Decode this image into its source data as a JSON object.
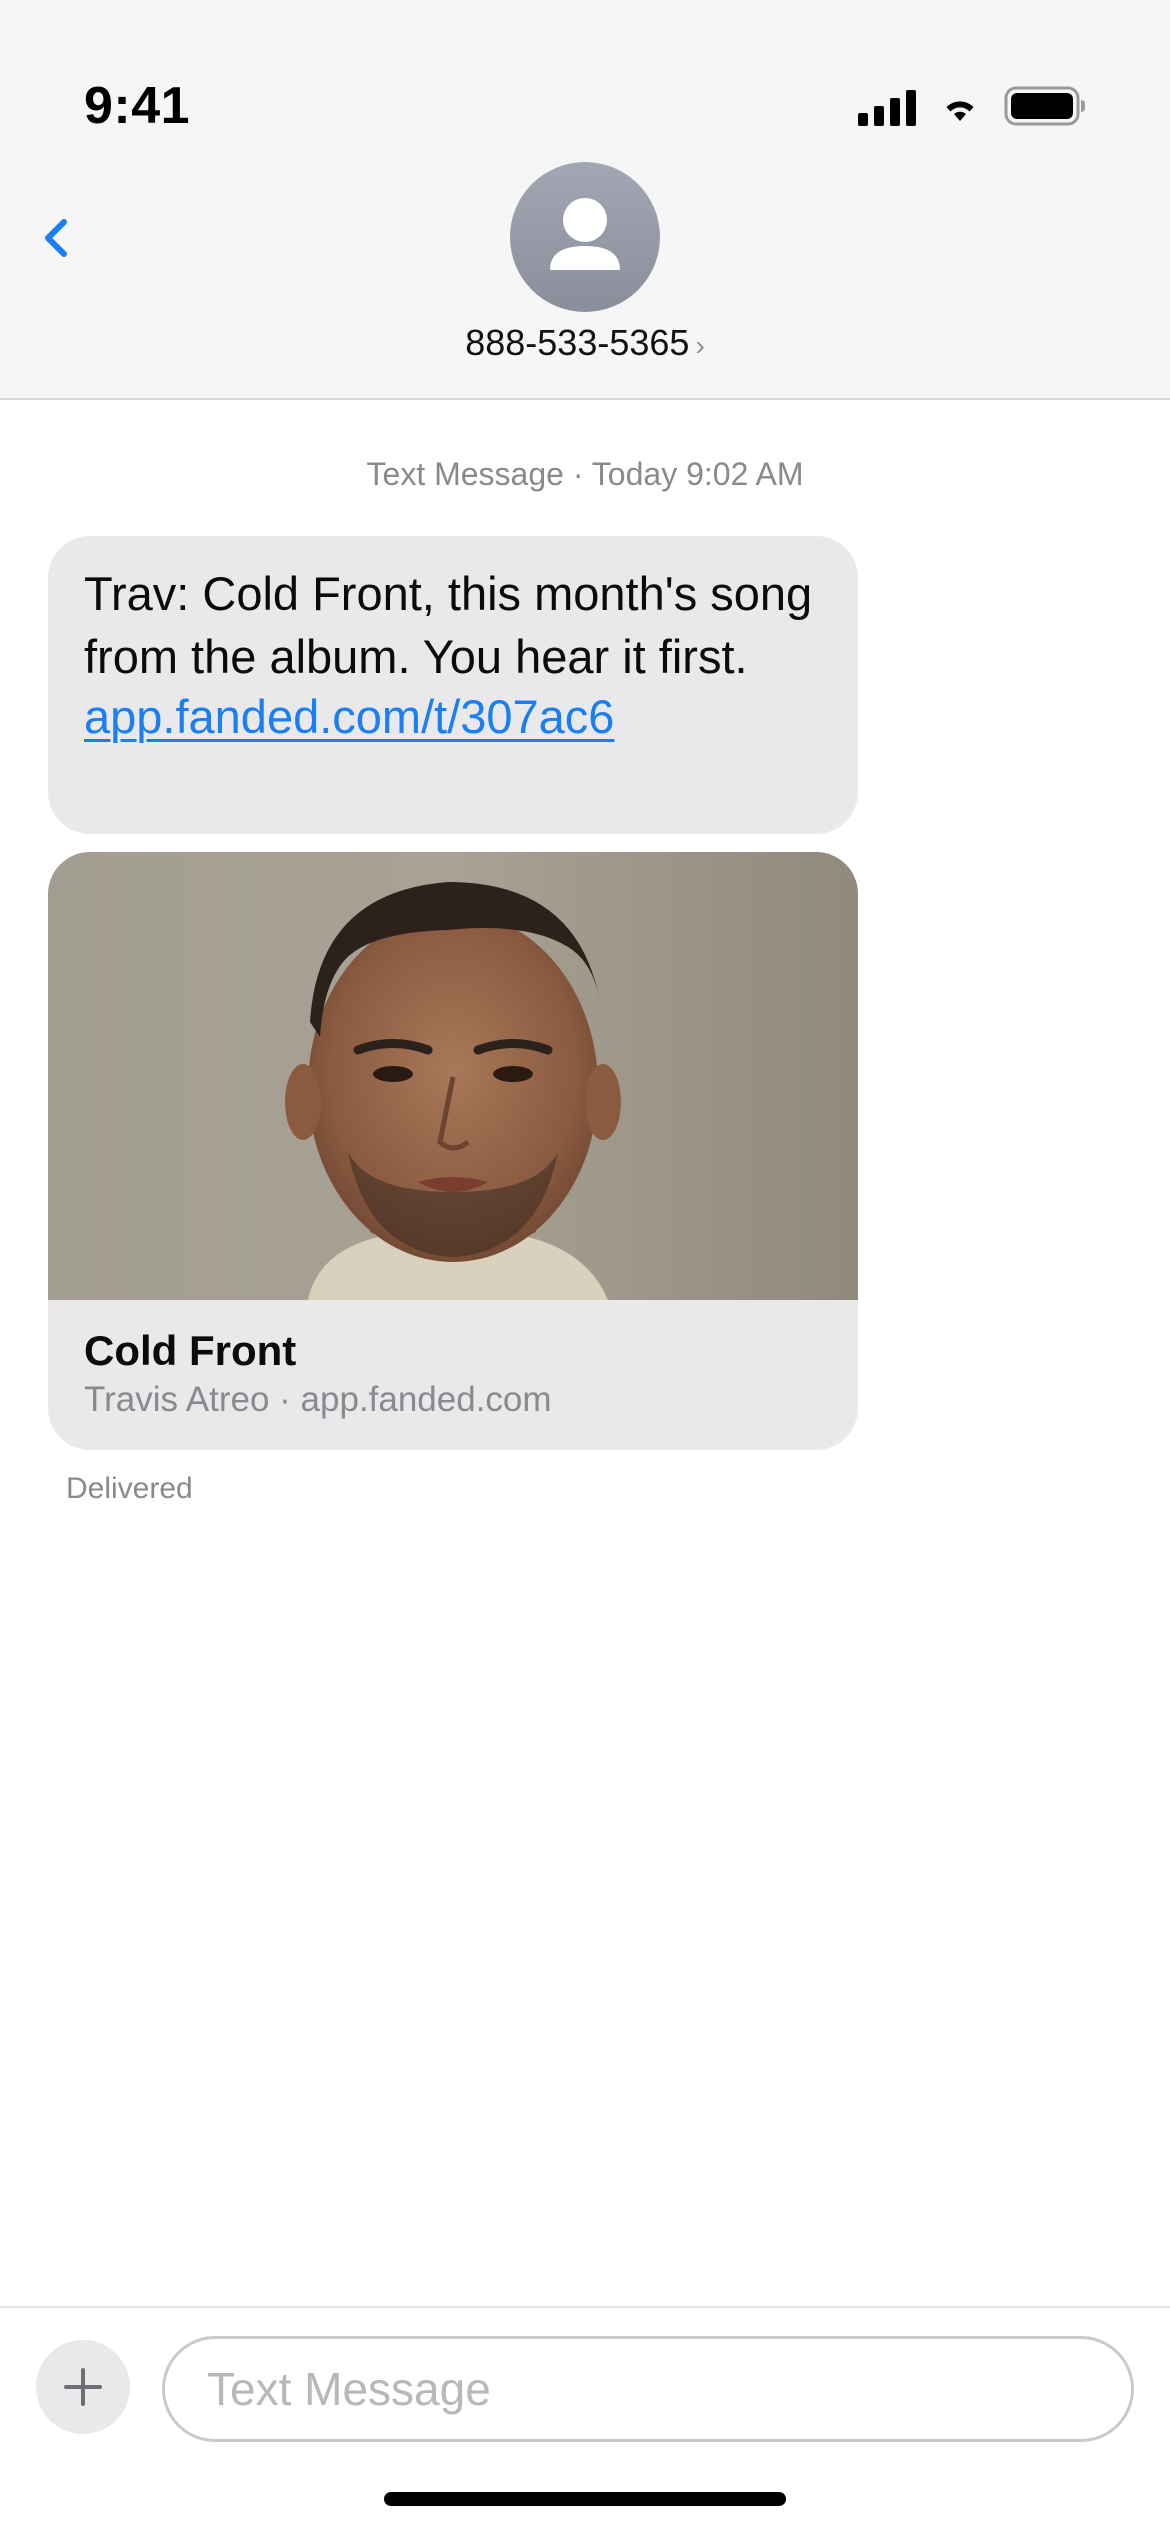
{
  "status_bar": {
    "time": "9:41"
  },
  "header": {
    "contact": "888-533-5365",
    "contact_chevron": "›"
  },
  "thread": {
    "service_label": "Text Message",
    "separator": " · ",
    "timestamp": "Today 9:02 AM",
    "message_text": "Trav: Cold Front, this month's song from the album. You hear it first.",
    "message_link": "app.fanded.com/t/307ac6",
    "link_preview": {
      "title": "Cold Front",
      "subtitle": "Travis Atreo · app.fanded.com"
    },
    "delivery_status": "Delivered"
  },
  "composer": {
    "placeholder": "Text Message"
  },
  "colors": {
    "link": "#1a7ef4",
    "bubble": "#e9e9eb",
    "header_bg": "#f6f6f7",
    "secondary_text": "#8a8a8e"
  },
  "icons": [
    "signal-icon",
    "wifi-icon",
    "battery-icon",
    "back-chevron-icon",
    "person-icon",
    "plus-icon"
  ]
}
